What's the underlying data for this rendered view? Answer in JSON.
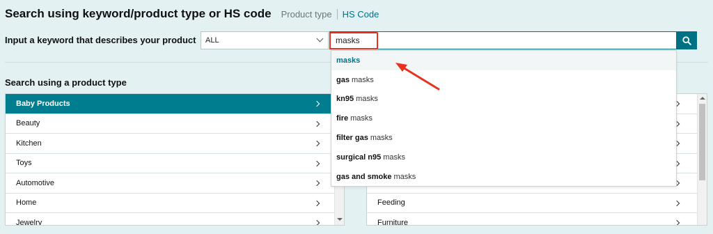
{
  "header": {
    "title": "Search using keyword/product type or HS code",
    "tab_product_type": "Product type",
    "tab_hs_code": "HS Code"
  },
  "keyword": {
    "label": "Input a keyword that describes your product",
    "category_selected": "ALL",
    "search_value": "masks"
  },
  "suggestions": [
    {
      "bold": "masks",
      "rest": ""
    },
    {
      "bold": "gas",
      "rest": "masks"
    },
    {
      "bold": "kn95",
      "rest": "masks"
    },
    {
      "bold": "fire",
      "rest": "masks"
    },
    {
      "bold": "filter gas",
      "rest": "masks"
    },
    {
      "bold": "surgical n95",
      "rest": "masks"
    },
    {
      "bold": "gas and smoke",
      "rest": "masks"
    }
  ],
  "product_type": {
    "label": "Search using a product type",
    "left_items": [
      "Baby Products",
      "Beauty",
      "Kitchen",
      "Toys",
      "Automotive",
      "Home",
      "Jewelry"
    ],
    "right_items": [
      "",
      "",
      "",
      "",
      "",
      "Feeding",
      "Furniture"
    ]
  },
  "colors": {
    "accent": "#007185",
    "active_row": "#007e8f",
    "annotation_red": "#e8321f",
    "background": "#e4f1f3"
  },
  "icons": {
    "search_button": "search-icon",
    "row_arrow": "chevron-right-icon",
    "select_arrow": "chevron-down-icon"
  }
}
